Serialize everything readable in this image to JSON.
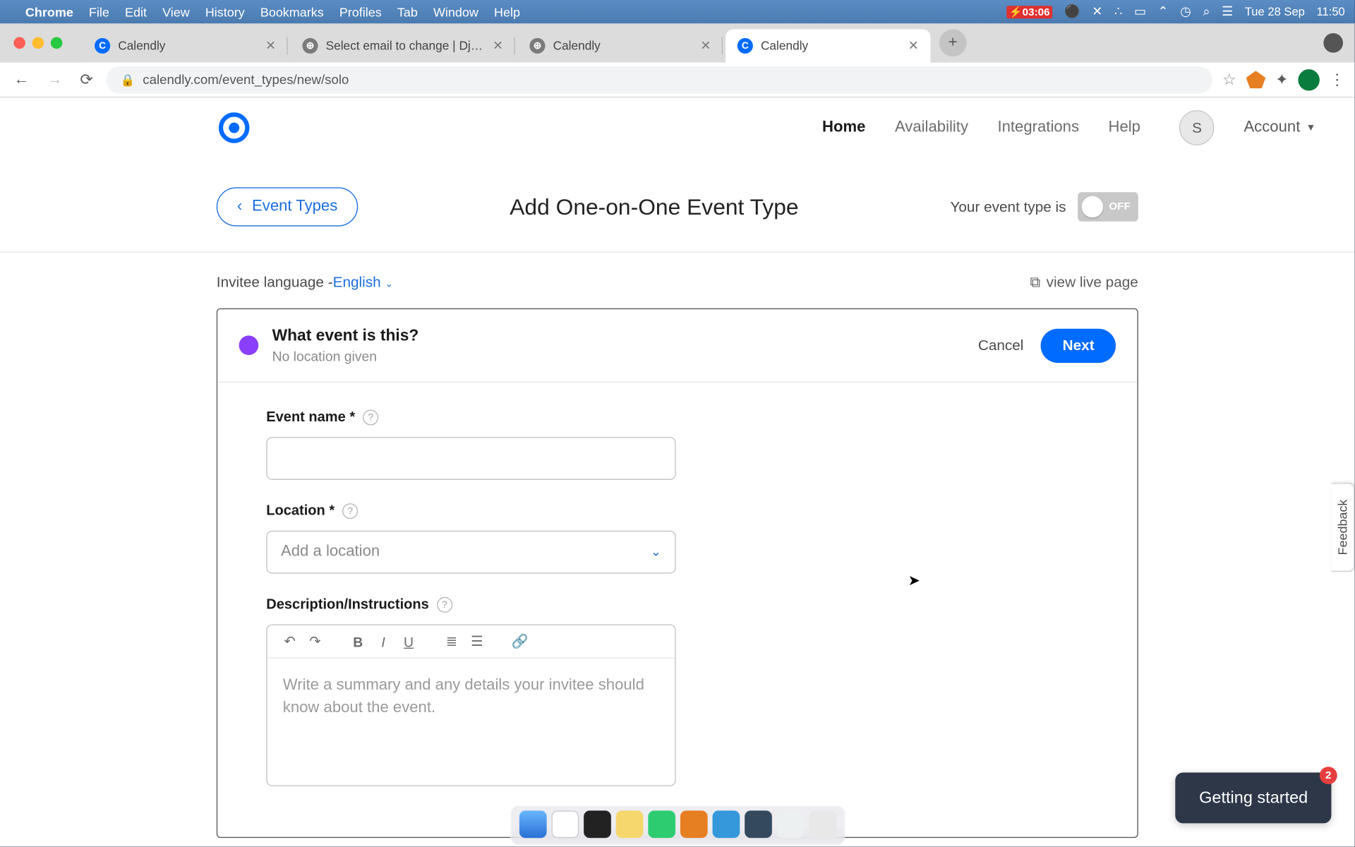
{
  "menubar": {
    "apple": "",
    "app": "Chrome",
    "items": [
      "File",
      "Edit",
      "View",
      "History",
      "Bookmarks",
      "Profiles",
      "Tab",
      "Window",
      "Help"
    ],
    "clock_small": "03:06",
    "date": "Tue 28 Sep",
    "clock": "11:50"
  },
  "browser": {
    "tabs": [
      {
        "title": "Calendly",
        "icon": "calendly"
      },
      {
        "title": "Select email to change | Django",
        "icon": "globe"
      },
      {
        "title": "Calendly",
        "icon": "globe"
      },
      {
        "title": "Calendly",
        "icon": "calendly",
        "active": true
      }
    ],
    "url": "calendly.com/event_types/new/solo"
  },
  "nav": {
    "items": [
      "Home",
      "Availability",
      "Integrations",
      "Help"
    ],
    "active": "Home",
    "avatar_letter": "S",
    "account_label": "Account"
  },
  "subheader": {
    "back_label": "Event Types",
    "title": "Add One-on-One Event Type",
    "toggle_label": "Your event type is",
    "toggle_state": "OFF"
  },
  "meta": {
    "invitee_lang_label": "Invitee language - ",
    "invitee_lang_value": "English",
    "view_live": "view live page"
  },
  "card": {
    "head_title": "What event is this?",
    "head_sub": "No location given",
    "cancel": "Cancel",
    "next": "Next",
    "fields": {
      "event_name_label": "Event name *",
      "location_label": "Location *",
      "location_placeholder": "Add a location",
      "description_label": "Description/Instructions",
      "description_placeholder": "Write a summary and any details your invitee should know about the event."
    }
  },
  "feedback_label": "Feedback",
  "getting_started": {
    "label": "Getting started",
    "count": "2"
  }
}
